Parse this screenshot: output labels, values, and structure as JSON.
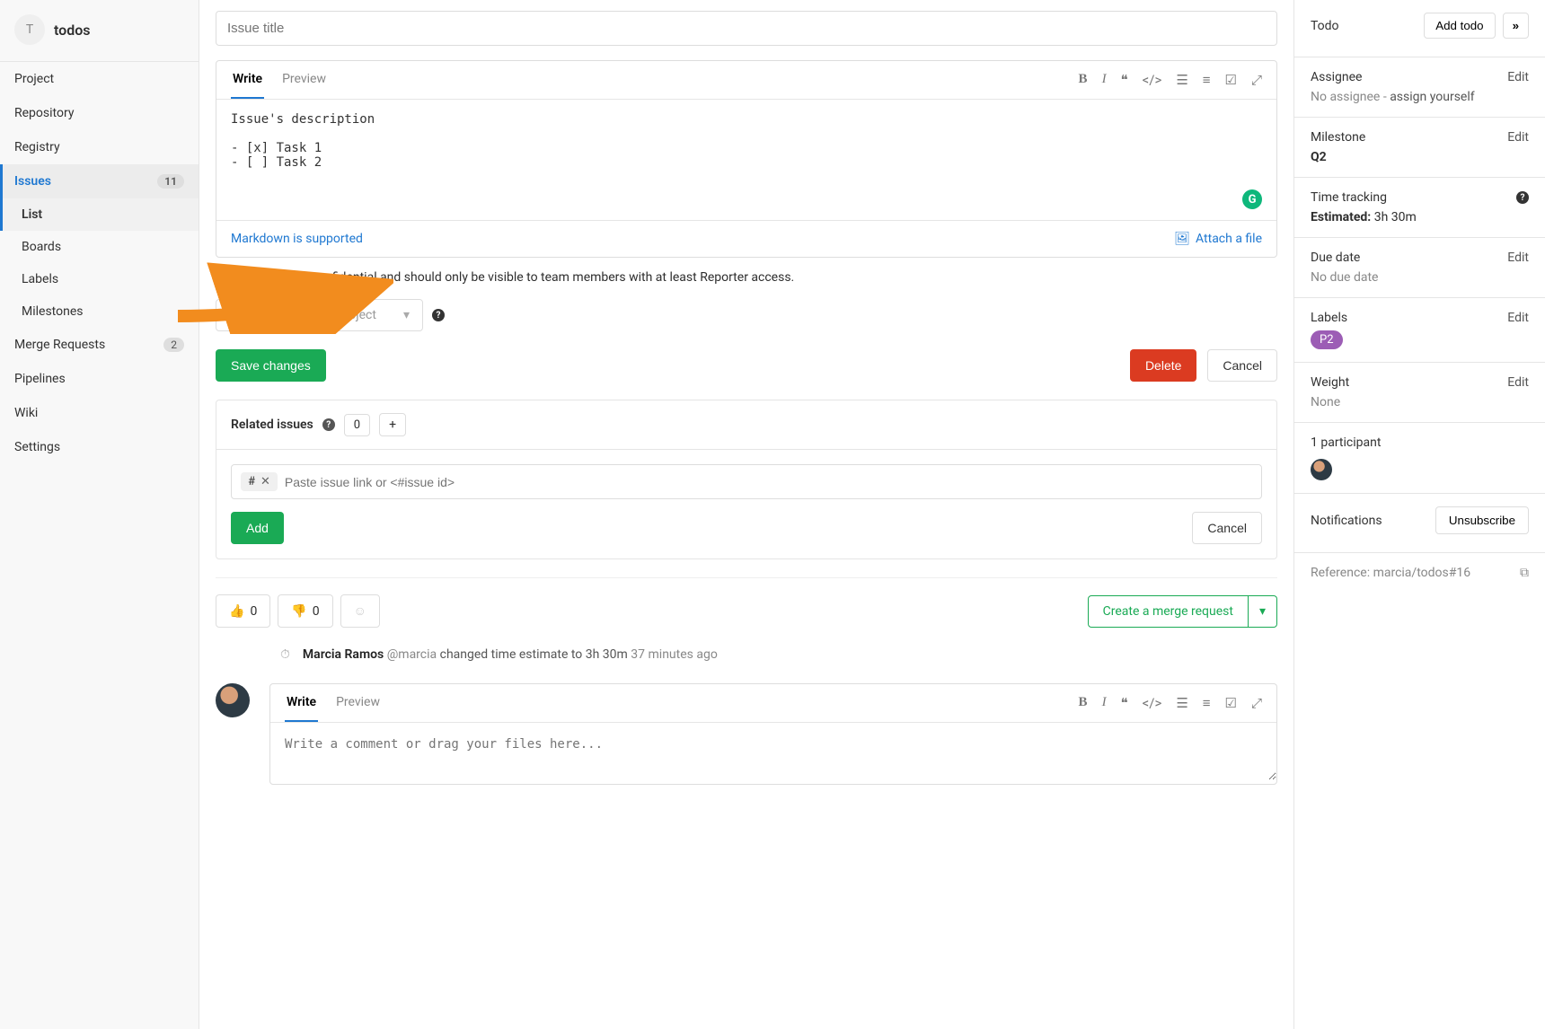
{
  "sidebar": {
    "avatar_letter": "T",
    "project_name": "todos",
    "items": [
      {
        "label": "Project"
      },
      {
        "label": "Repository"
      },
      {
        "label": "Registry"
      },
      {
        "label": "Issues",
        "active": true,
        "badge": "11",
        "subs": [
          {
            "label": "List",
            "active": true
          },
          {
            "label": "Boards"
          },
          {
            "label": "Labels"
          },
          {
            "label": "Milestones"
          }
        ]
      },
      {
        "label": "Merge Requests",
        "badge": "2"
      },
      {
        "label": "Pipelines"
      },
      {
        "label": "Wiki"
      },
      {
        "label": "Settings"
      }
    ]
  },
  "main": {
    "title_placeholder": "Issue title",
    "editor": {
      "tab_write": "Write",
      "tab_preview": "Preview",
      "body": "Issue's description\n\n- [x] Task 1\n- [ ] Task 2",
      "markdown_link": "Markdown is supported",
      "attach_link": "Attach a file"
    },
    "confidential": {
      "checked": true,
      "text": "This issue is confidential and should only be visible to team members with at least Reporter access."
    },
    "move_placeholder": "Move to a different project",
    "save_btn": "Save changes",
    "delete_btn": "Delete",
    "cancel_btn": "Cancel",
    "related": {
      "title": "Related issues",
      "count": "0",
      "chip": "#",
      "placeholder": "Paste issue link or <#issue id>",
      "add_btn": "Add",
      "cancel_btn": "Cancel"
    },
    "reactions": {
      "thumbs_up": "0",
      "thumbs_down": "0"
    },
    "mr_btn": "Create a merge request",
    "activity": {
      "author": "Marcia Ramos",
      "handle": "@marcia",
      "text": "changed time estimate to 3h 30m",
      "time": "37 minutes ago"
    },
    "comment": {
      "tab_write": "Write",
      "tab_preview": "Preview",
      "placeholder": "Write a comment or drag your files here..."
    }
  },
  "right": {
    "todo": {
      "label": "Todo",
      "add_btn": "Add todo",
      "expand": "»"
    },
    "assignee": {
      "label": "Assignee",
      "edit": "Edit",
      "value": "No assignee -",
      "assign": " assign yourself"
    },
    "milestone": {
      "label": "Milestone",
      "edit": "Edit",
      "value": "Q2"
    },
    "time": {
      "label": "Time tracking",
      "estimated_label": "Estimated:",
      "estimated_value": " 3h 30m"
    },
    "due": {
      "label": "Due date",
      "edit": "Edit",
      "value": "No due date"
    },
    "labels": {
      "label": "Labels",
      "edit": "Edit",
      "pill": "P2"
    },
    "weight": {
      "label": "Weight",
      "edit": "Edit",
      "value": "None"
    },
    "participants": {
      "label": "1 participant"
    },
    "notifications": {
      "label": "Notifications",
      "btn": "Unsubscribe"
    },
    "reference": {
      "label": "Reference: ",
      "value": "marcia/todos#16"
    }
  }
}
